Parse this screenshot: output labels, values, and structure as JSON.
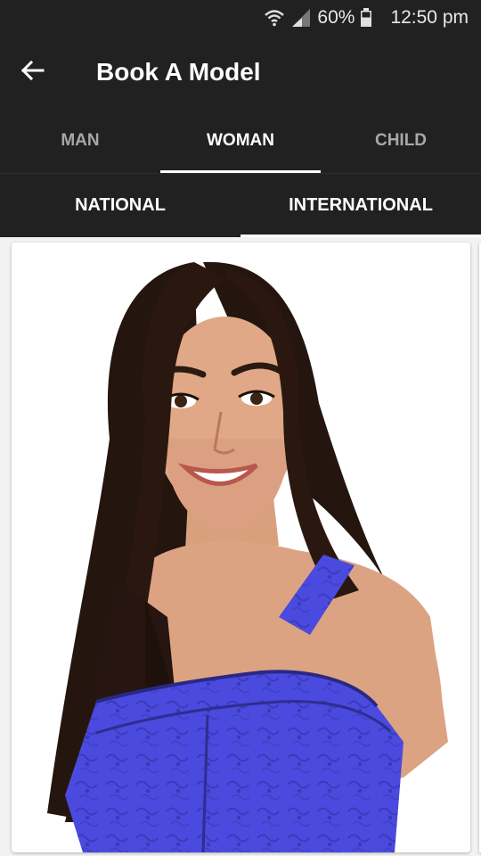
{
  "status_bar": {
    "battery": "60%",
    "time": "12:50 pm",
    "icons": [
      "wifi-icon",
      "signal-icon",
      "battery-icon"
    ]
  },
  "app_bar": {
    "title": "Book A Model",
    "back_icon": "arrow-back-icon"
  },
  "tabs": [
    {
      "label": "MAN",
      "active": false
    },
    {
      "label": "WOMAN",
      "active": true
    },
    {
      "label": "CHILD",
      "active": false
    }
  ],
  "subtabs": [
    {
      "label": "NATIONAL",
      "active": false
    },
    {
      "label": "INTERNATIONAL",
      "active": true
    }
  ],
  "colors": {
    "bar_background": "#212121",
    "active_text": "#ffffff",
    "inactive_text": "#a8a8a8",
    "dress_blue": "#4a4adf"
  }
}
